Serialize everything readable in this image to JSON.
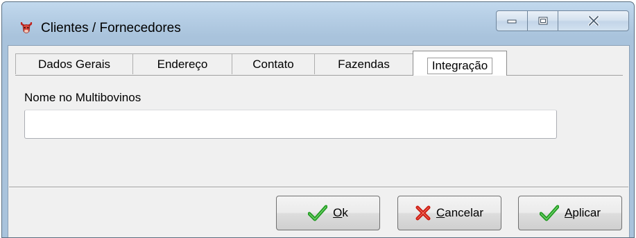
{
  "window": {
    "title": "Clientes / Fornecedores",
    "app_icon": "cow-head-icon",
    "controls": {
      "minimize_icon": "minimize-icon",
      "maximize_icon": "maximize-icon",
      "close_icon": "close-icon"
    }
  },
  "tabs": [
    {
      "label": "Dados Gerais",
      "active": false
    },
    {
      "label": "Endereço",
      "active": false
    },
    {
      "label": "Contato",
      "active": false
    },
    {
      "label": "Fazendas",
      "active": false
    },
    {
      "label": "Integração",
      "active": true
    }
  ],
  "form": {
    "field_label": "Nome no Multibovinos",
    "field_value": ""
  },
  "buttons": {
    "ok": {
      "mnemonic": "O",
      "rest": "k",
      "icon": "checkmark-icon"
    },
    "cancel": {
      "mnemonic": "C",
      "rest": "ancelar",
      "icon": "x-cross-icon"
    },
    "apply": {
      "mnemonic": "A",
      "rest": "plicar",
      "icon": "checkmark-icon"
    }
  },
  "colors": {
    "check_green": "#1f9a1f",
    "cross_red": "#cc1a10",
    "title_gradient_top": "#c2d9ee",
    "face": "#f0f0f0"
  }
}
